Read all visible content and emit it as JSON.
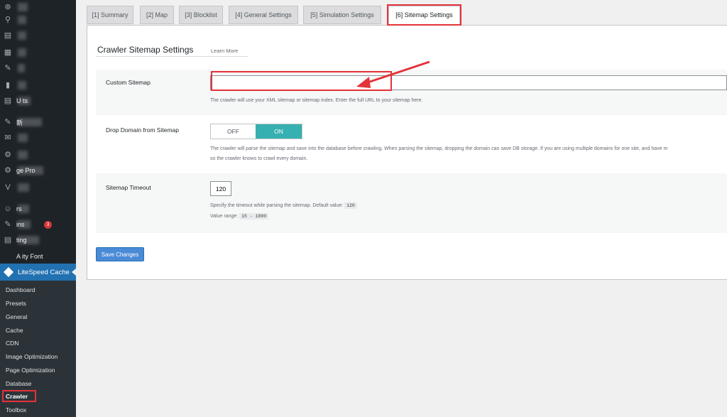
{
  "sidebar": {
    "items": [
      {
        "icon": "dashboard-icon",
        "glyph": "⊛",
        "text": ""
      },
      {
        "icon": "updates-icon",
        "glyph": "⚲",
        "text": ""
      },
      {
        "icon": "inbox-icon",
        "glyph": "▤",
        "text": ""
      },
      {
        "icon": "pages-icon",
        "glyph": "▦",
        "text": ""
      },
      {
        "icon": "pin-icon",
        "glyph": "✎",
        "text": ""
      },
      {
        "icon": "comments-icon",
        "glyph": "▮",
        "text": ""
      },
      {
        "icon": "list-icon",
        "glyph": "▤",
        "text": "U      ts"
      },
      {
        "icon": "tools-icon",
        "glyph": "✎",
        "text": "  新"
      },
      {
        "icon": "mail-icon",
        "glyph": "✉",
        "text": ""
      },
      {
        "icon": "settings-icon",
        "glyph": "⚙",
        "text": ""
      },
      {
        "icon": "settings-gear-icon",
        "glyph": "⚙",
        "text": "      ge        Pro"
      },
      {
        "icon": "plugin-v-icon",
        "glyph": "V",
        "text": ""
      },
      {
        "icon": "users-icon",
        "glyph": "☺",
        "text": "    rs"
      },
      {
        "icon": "plugins-icon",
        "glyph": "✎",
        "text": "   ins",
        "badge": "3"
      },
      {
        "icon": "settings-list-icon",
        "glyph": "▤",
        "text": "    ting"
      },
      {
        "icon": "font-icon",
        "glyph": "",
        "text": "A          ity Font"
      }
    ],
    "active_label": "LiteSpeed Cache",
    "submenu": [
      "Dashboard",
      "Presets",
      "General",
      "Cache",
      "CDN",
      "Image Optimization",
      "Page Optimization",
      "Database",
      "Crawler",
      "Toolbox"
    ]
  },
  "tabs": [
    {
      "label": "[1] Summary"
    },
    {
      "label": "[2] Map"
    },
    {
      "label": "[3] Blocklist"
    },
    {
      "label": "[4] General Settings"
    },
    {
      "label": "[5] Simulation Settings"
    },
    {
      "label": "[6] Sitemap Settings"
    }
  ],
  "main": {
    "title": "Crawler Sitemap Settings",
    "learn_more": "Learn More",
    "custom_sitemap": {
      "label": "Custom Sitemap",
      "value": "",
      "description": "The crawler will use your XML sitemap or sitemap index. Enter the full URL to your sitemap here."
    },
    "drop_domain": {
      "label": "Drop Domain from Sitemap",
      "off_label": "OFF",
      "on_label": "ON",
      "selected": "ON",
      "description_line1": "The crawler will parse the sitemap and save into the database before crawling. When parsing the sitemap, dropping the domain can save DB storage. If you are using multiple domains for one site, and have m",
      "description_line2": "so the crawler knows to crawl every domain."
    },
    "timeout": {
      "label": "Sitemap Timeout",
      "value": "120",
      "description": "Specify the timeout while parsing the sitemap. Default value:",
      "default_value": "120",
      "range_label": "Value range:",
      "range_value": "15 - 1800"
    },
    "save_label": "Save Changes"
  },
  "colors": {
    "sidebar_bg": "#1d2327",
    "accent": "#2271b1",
    "toggle_on": "#36b0b0",
    "highlight": "#e4323a"
  }
}
